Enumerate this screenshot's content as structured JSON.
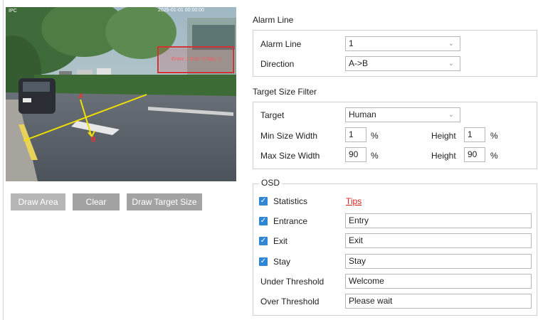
{
  "video": {
    "timestamp": "2025-01-01 00:00:00",
    "corner_text": "IPC",
    "overlay_text": "Enter: 1  Exit: 0  Stay: 1",
    "point_a": "A",
    "point_b": "B"
  },
  "camera_buttons": {
    "draw_area": "Draw Area",
    "clear": "Clear",
    "draw_target_size": "Draw Target Size"
  },
  "alarm_line": {
    "title": "Alarm Line",
    "line_label": "Alarm Line",
    "line_value": "1",
    "direction_label": "Direction",
    "direction_value": "A->B"
  },
  "target_size_filter": {
    "title": "Target Size Filter",
    "target_label": "Target",
    "target_value": "Human",
    "min_width_label": "Min Size Width",
    "min_width_value": "1",
    "min_height_label": "Height",
    "min_height_value": "1",
    "max_width_label": "Max Size Width",
    "max_width_value": "90",
    "max_height_label": "Height",
    "max_height_value": "90",
    "unit": "%"
  },
  "osd": {
    "title": "OSD",
    "statistics_label": "Statistics",
    "tips_label": "Tips",
    "entrance_label": "Entrance",
    "entrance_value": "Entry",
    "exit_label": "Exit",
    "exit_value": "Exit",
    "stay_label": "Stay",
    "stay_value": "Stay",
    "under_threshold_label": "Under Threshold",
    "under_threshold_value": "Welcome",
    "over_threshold_label": "Over Threshold",
    "over_threshold_value": "Please wait",
    "checks": {
      "statistics": true,
      "entrance": true,
      "exit": true,
      "stay": true
    }
  },
  "colors": {
    "checkbox": "#2f86d4",
    "tips_link": "#d42020",
    "alarm_line": "#f0e000",
    "button_gray": "#a3a3a3"
  },
  "icons": {
    "checkbox": "check-icon",
    "select_arrow": "chevron-down-icon"
  }
}
